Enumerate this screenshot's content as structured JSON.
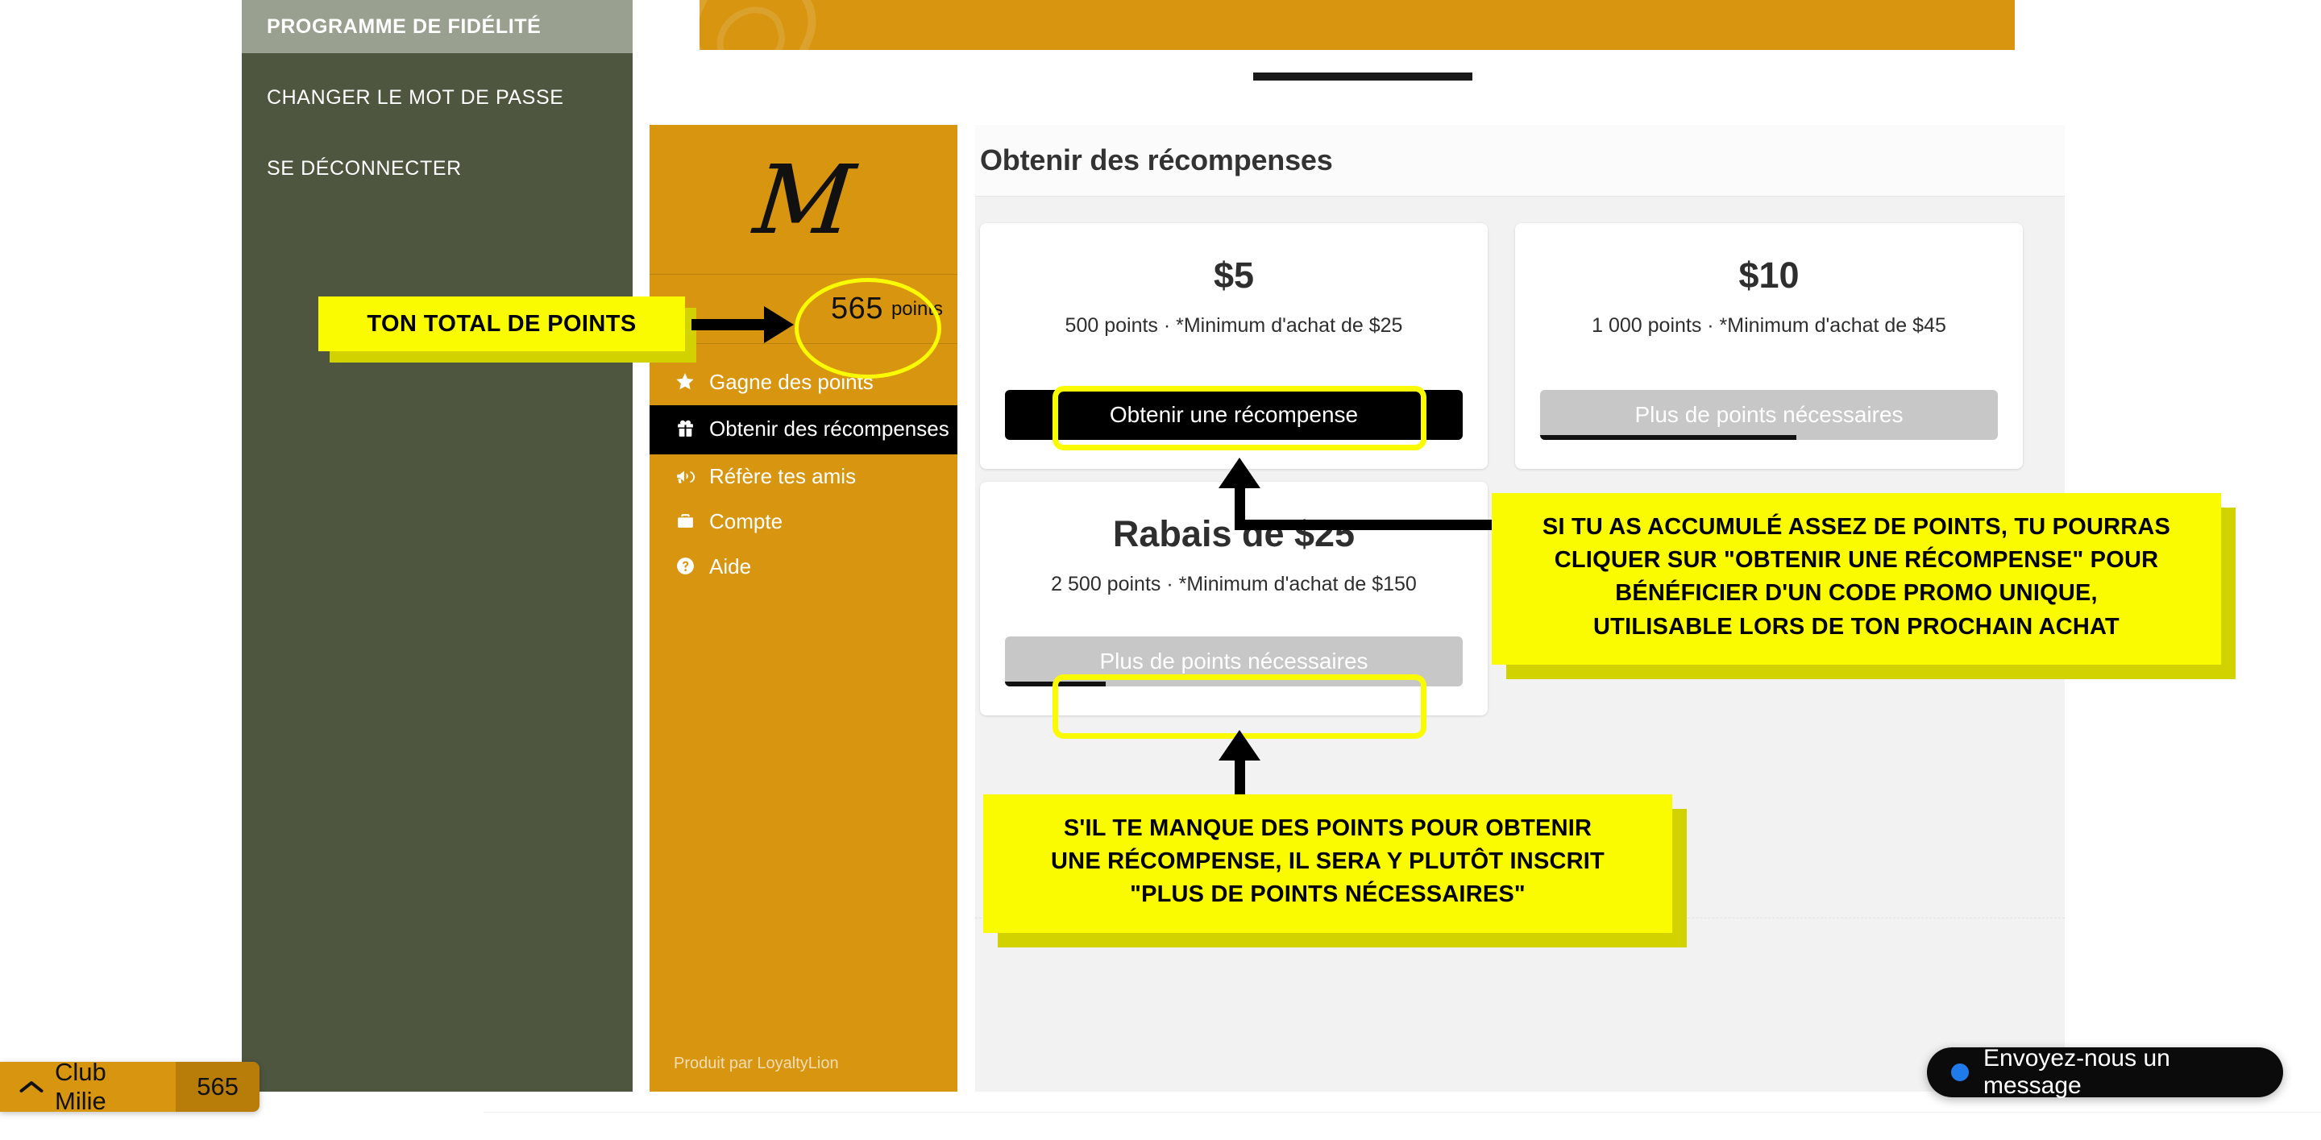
{
  "account_sidebar": {
    "items": [
      {
        "label": "PROGRAMME DE FIDÉLITÉ",
        "active": true
      },
      {
        "label": "CHANGER LE MOT DE PASSE",
        "active": false
      },
      {
        "label": "SE DÉCONNECTER",
        "active": false
      }
    ]
  },
  "loyalty_widget": {
    "logo_letter": "M",
    "points_value": "565",
    "points_unit": "points",
    "menu": [
      {
        "label": "Gagne des points",
        "icon": "star-icon",
        "active": false
      },
      {
        "label": "Obtenir des récompenses",
        "icon": "gift-icon",
        "active": true
      },
      {
        "label": "Réfère tes amis",
        "icon": "megaphone-icon",
        "active": false
      },
      {
        "label": "Compte",
        "icon": "briefcase-icon",
        "active": false
      },
      {
        "label": "Aide",
        "icon": "question-circle-icon",
        "active": false
      }
    ],
    "footer": "Produit par LoyaltyLion"
  },
  "rewards_panel": {
    "title": "Obtenir des récompenses",
    "cards": [
      {
        "amount": "$5",
        "sub": "500 points · *Minimum d'achat de $25",
        "button_label": "Obtenir une récompense",
        "enabled": true,
        "progress_pct": 0
      },
      {
        "amount": "$10",
        "sub": "1 000 points · *Minimum d'achat de $45",
        "button_label": "Plus de points nécessaires",
        "enabled": false,
        "progress_pct": 56
      },
      {
        "amount": "Rabais de $25",
        "sub": "2 500 points · *Minimum d'achat de $150",
        "button_label": "Plus de points nécessaires",
        "enabled": false,
        "progress_pct": 22
      }
    ]
  },
  "annotations": {
    "total_points": "TON TOTAL DE POINTS",
    "reward_info": {
      "line1": "SI TU AS ACCUMULÉ ASSEZ DE POINTS, TU POURRAS",
      "line2": "CLIQUER SUR \"OBTENIR UNE RÉCOMPENSE\" POUR",
      "line3": "BÉNÉFICIER D'UN CODE PROMO UNIQUE,",
      "line4": "UTILISABLE LORS DE TON PROCHAIN ACHAT"
    },
    "more_points_info": {
      "line1": "S'IL TE MANQUE DES POINTS POUR OBTENIR",
      "line2": "UNE RÉCOMPENSE, IL SERA Y PLUTÔT INSCRIT",
      "line3": "\"PLUS DE POINTS NÉCESSAIRES\""
    }
  },
  "club_launcher": {
    "label": "Club Milie",
    "count": "565",
    "icon": "chevron-up-icon"
  },
  "chat_launcher": {
    "label": "Envoyez-nous un message",
    "status_icon": "online-dot-icon"
  },
  "colors": {
    "brand_orange": "#d79510",
    "sidebar_green": "#4f563f",
    "sidebar_active": "#9aa090",
    "highlight_yellow": "#fbfb00",
    "highlight_shadow": "#d2d200",
    "chat_blue": "#1f7aec",
    "disabled_gray": "#c7c7c7"
  }
}
